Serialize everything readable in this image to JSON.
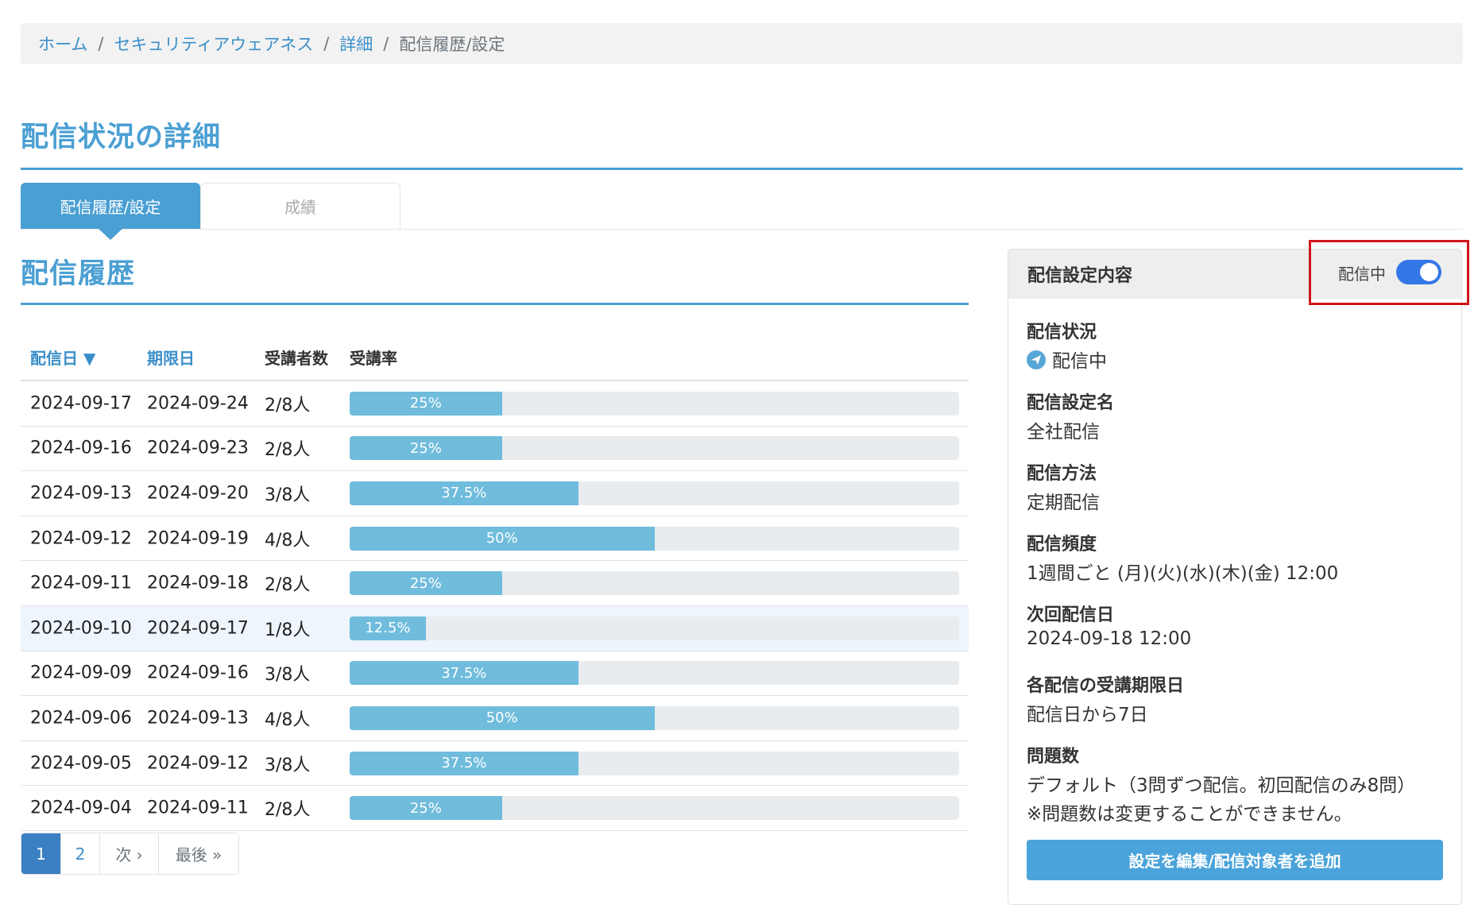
{
  "breadcrumb": {
    "items": [
      "ホーム",
      "セキュリティアウェアネス",
      "詳細",
      "配信履歴/設定"
    ],
    "separator": "/"
  },
  "page_title": "配信状況の詳細",
  "tabs": [
    {
      "label": "配信履歴/設定",
      "active": true
    },
    {
      "label": "成績",
      "active": false
    }
  ],
  "history": {
    "title": "配信履歴",
    "columns": {
      "delivery_date": "配信日 ▼",
      "due_date": "期限日",
      "participants": "受講者数",
      "rate": "受講率"
    },
    "rows": [
      {
        "delivery_date": "2024-09-17",
        "due_date": "2024-09-24",
        "participants": "2/8人",
        "rate_label": "25%",
        "rate": 25
      },
      {
        "delivery_date": "2024-09-16",
        "due_date": "2024-09-23",
        "participants": "2/8人",
        "rate_label": "25%",
        "rate": 25
      },
      {
        "delivery_date": "2024-09-13",
        "due_date": "2024-09-20",
        "participants": "3/8人",
        "rate_label": "37.5%",
        "rate": 37.5
      },
      {
        "delivery_date": "2024-09-12",
        "due_date": "2024-09-19",
        "participants": "4/8人",
        "rate_label": "50%",
        "rate": 50
      },
      {
        "delivery_date": "2024-09-11",
        "due_date": "2024-09-18",
        "participants": "2/8人",
        "rate_label": "25%",
        "rate": 25
      },
      {
        "delivery_date": "2024-09-10",
        "due_date": "2024-09-17",
        "participants": "1/8人",
        "rate_label": "12.5%",
        "rate": 12.5,
        "highlight": true
      },
      {
        "delivery_date": "2024-09-09",
        "due_date": "2024-09-16",
        "participants": "3/8人",
        "rate_label": "37.5%",
        "rate": 37.5
      },
      {
        "delivery_date": "2024-09-06",
        "due_date": "2024-09-13",
        "participants": "4/8人",
        "rate_label": "50%",
        "rate": 50
      },
      {
        "delivery_date": "2024-09-05",
        "due_date": "2024-09-12",
        "participants": "3/8人",
        "rate_label": "37.5%",
        "rate": 37.5
      },
      {
        "delivery_date": "2024-09-04",
        "due_date": "2024-09-11",
        "participants": "2/8人",
        "rate_label": "25%",
        "rate": 25
      }
    ]
  },
  "pagination": {
    "pages": [
      "1",
      "2"
    ],
    "current": "1",
    "next": "次 ›",
    "last": "最後 »"
  },
  "settings_panel": {
    "title": "配信設定内容",
    "toggle": {
      "label": "配信中",
      "on": true
    },
    "fields": [
      {
        "label": "配信状況",
        "value": "配信中",
        "icon": "send-icon"
      },
      {
        "label": "配信設定名",
        "value": "全社配信"
      },
      {
        "label": "配信方法",
        "value": "定期配信"
      },
      {
        "label": "配信頻度",
        "value": "1週間ごと (月)(火)(水)(木)(金) 12:00"
      },
      {
        "label": "次回配信日",
        "value": "2024-09-18 12:00"
      },
      {
        "label": "各配信の受講期限日",
        "value": "配信日から7日"
      },
      {
        "label": "問題数",
        "value": "デフォルト（3問ずつ配信。初回配信のみ8問）",
        "note": "※問題数は変更することができません。"
      }
    ],
    "edit_button": "設定を編集/配信対象者を追加"
  },
  "colors": {
    "accent": "#4a9fd3",
    "bar_fill": "#6fbcdc",
    "bar_track": "#e9ecef",
    "toggle_on": "#3477e6",
    "highlight_border": "#d0141a"
  }
}
